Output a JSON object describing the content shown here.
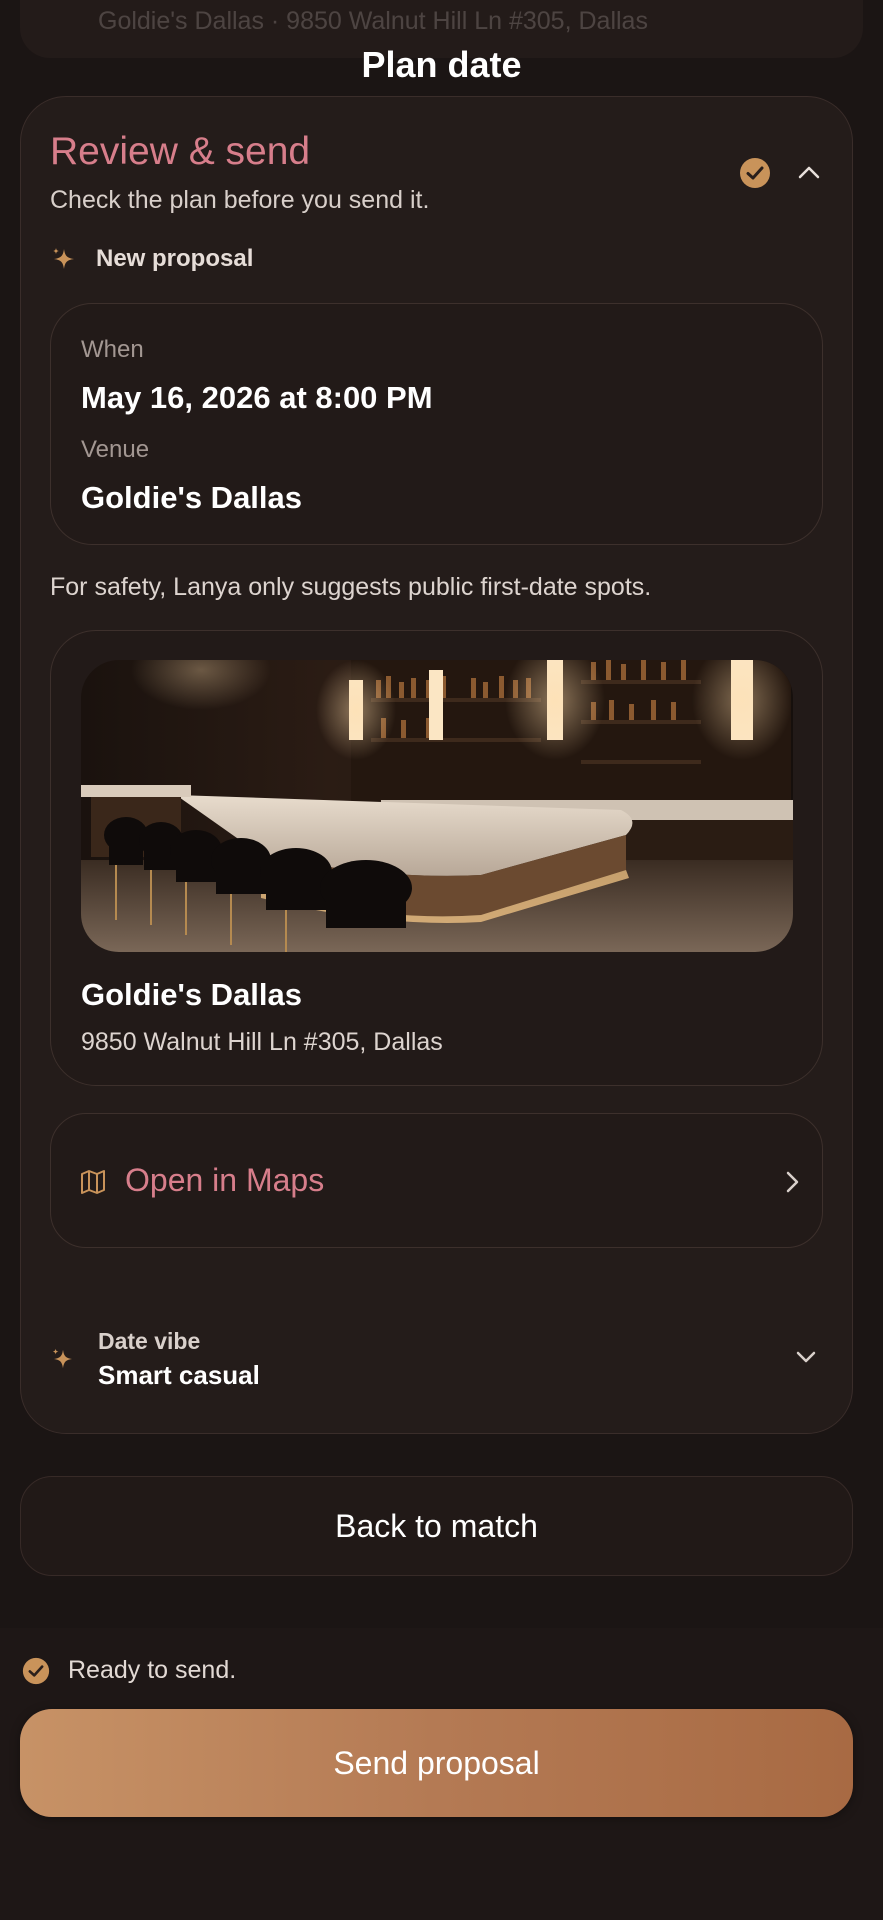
{
  "header": {
    "ghost_text": "Goldie's Dallas · 9850 Walnut Hill Ln #305, Dallas",
    "title": "Plan date"
  },
  "review": {
    "title": "Review & send",
    "subtitle": "Check the plan before you send it.",
    "proposal_label": "New proposal",
    "when_label": "When",
    "when_value": "May 16, 2026 at 8:00 PM",
    "venue_label": "Venue",
    "venue_value": "Goldie's Dallas",
    "safety_note": "For safety, Lanya only suggests public first-date spots.",
    "venue_card": {
      "name": "Goldie's Dallas",
      "address": "9850 Walnut Hill Ln #305,  Dallas"
    },
    "maps_label": "Open in Maps",
    "vibe_label": "Date vibe",
    "vibe_value": "Smart casual"
  },
  "actions": {
    "back_label": "Back to match",
    "ready_label": "Ready to send.",
    "send_label": "Send proposal"
  },
  "colors": {
    "accent_pink": "#d77e8b",
    "accent_gold": "#c9935a",
    "background": "#1b1514",
    "card": "#241c1a"
  }
}
